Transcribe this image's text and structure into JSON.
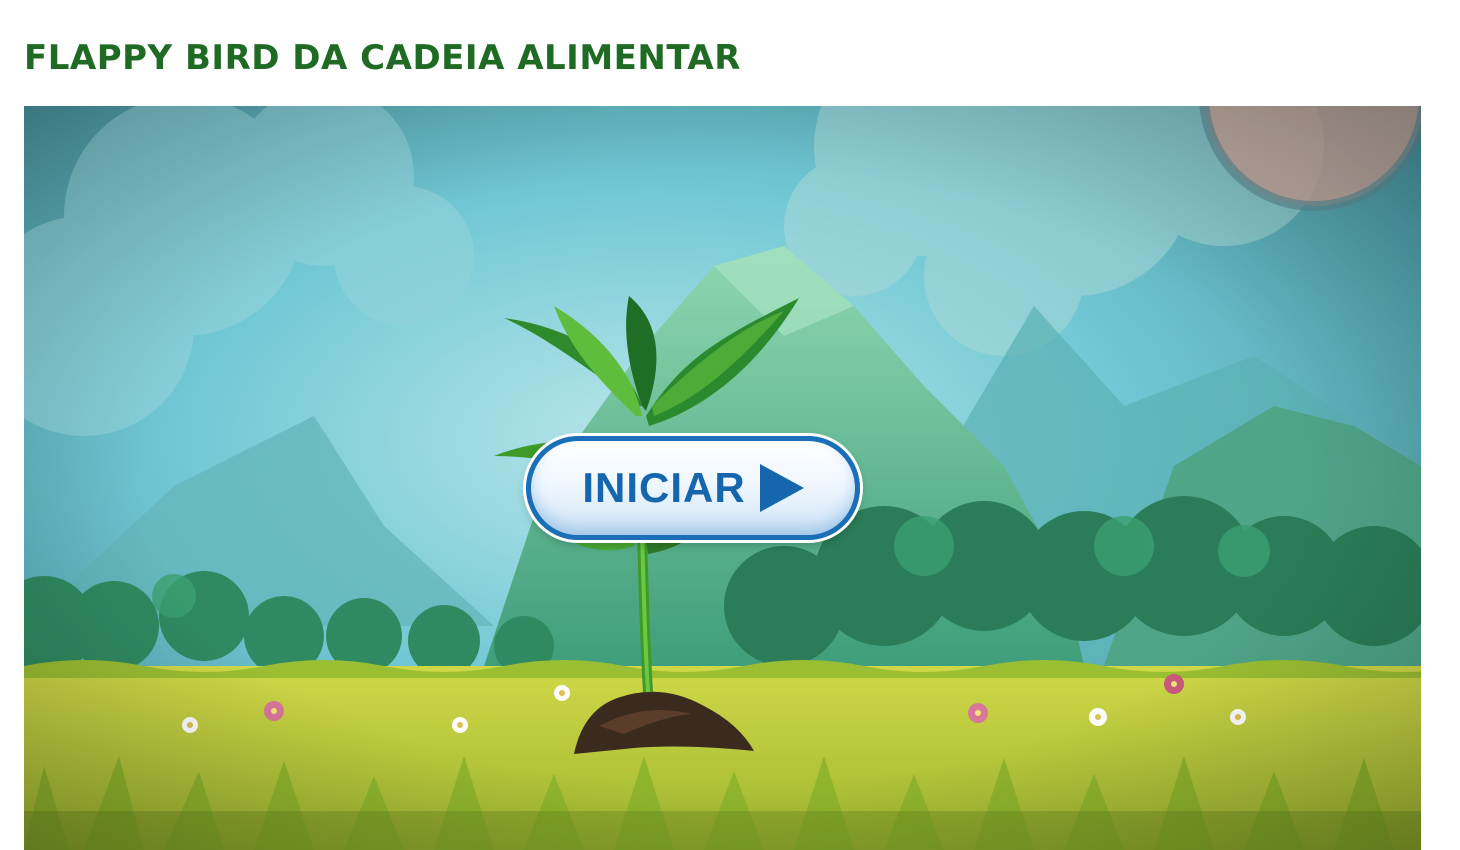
{
  "page": {
    "title": "FLAPPY BIRD DA CADEIA ALIMENTAR"
  },
  "game": {
    "start_button_label": "INICIAR",
    "start_button_icon": "play-icon",
    "colors": {
      "title": "#1f6b23",
      "button_text": "#1566ad",
      "button_border": "#1a6fb8",
      "sky": "#6cc7d6",
      "grass": "#b7c83a"
    }
  }
}
